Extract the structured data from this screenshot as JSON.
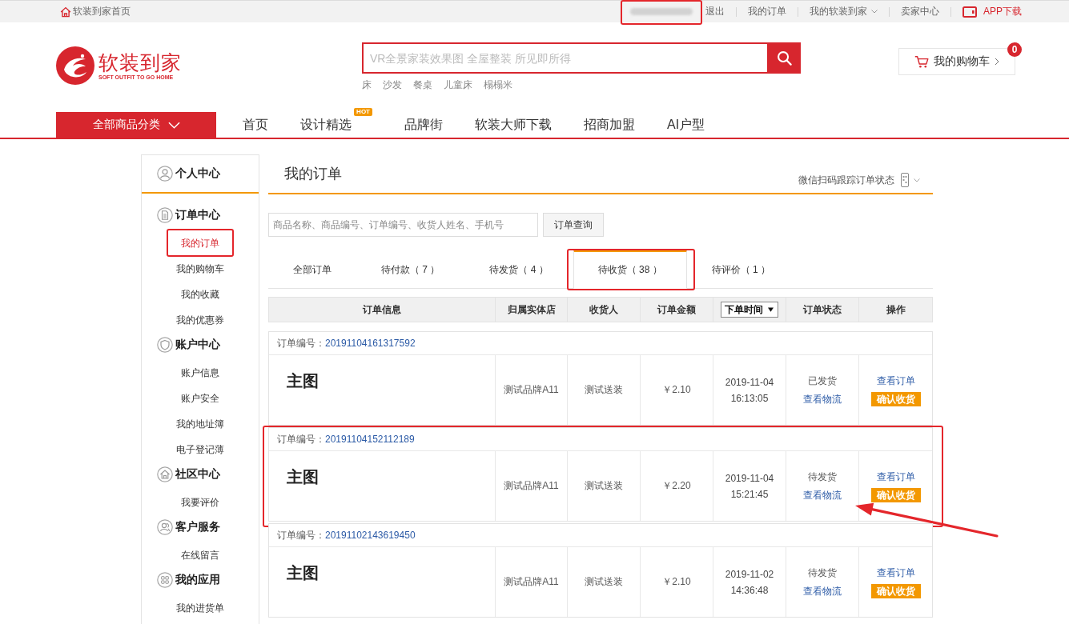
{
  "top_bar": {
    "home_link": "软装到家首页",
    "user": {
      "redacted": true,
      "highlighted": true
    },
    "links": [
      {
        "label": "退出",
        "kind": "link"
      },
      {
        "label": "我的订单",
        "kind": "link"
      },
      {
        "label": "我的软装到家",
        "kind": "menu"
      },
      {
        "label": "卖家中心",
        "kind": "link"
      },
      {
        "label": "APP下载",
        "kind": "app"
      }
    ]
  },
  "header": {
    "logo": {
      "name": "软装到家",
      "tagline": "SOFT OUTFIT TO GO HOME"
    },
    "search": {
      "placeholder": "VR全景家装效果图 全屋整装 所见即所得"
    },
    "hot_words": [
      "床",
      "沙发",
      "餐桌",
      "儿童床",
      "榻榻米"
    ],
    "cart": {
      "label": "我的购物车",
      "count": "0"
    }
  },
  "nav": {
    "category_button": "全部商品分类",
    "items": [
      {
        "label": "首页"
      },
      {
        "label": "设计精选",
        "badge": "HOT"
      },
      {
        "label": "品牌街"
      },
      {
        "label": "软装大师下载"
      },
      {
        "label": "招商加盟"
      },
      {
        "label": "AI户型"
      }
    ]
  },
  "sidebar": {
    "title": "个人中心",
    "groups": [
      {
        "title": "订单中心",
        "items": [
          {
            "label": "我的订单",
            "selected": true,
            "highlighted": true
          },
          {
            "label": "我的购物车",
            "selected": false,
            "highlighted": false
          },
          {
            "label": "我的收藏",
            "selected": false,
            "highlighted": false
          },
          {
            "label": "我的优惠券",
            "selected": false,
            "highlighted": false
          }
        ]
      },
      {
        "title": "账户中心",
        "items": [
          {
            "label": "账户信息",
            "selected": false,
            "highlighted": false
          },
          {
            "label": "账户安全",
            "selected": false,
            "highlighted": false
          },
          {
            "label": "我的地址簿",
            "selected": false,
            "highlighted": false
          },
          {
            "label": "电子登记薄",
            "selected": false,
            "highlighted": false
          }
        ]
      },
      {
        "title": "社区中心",
        "items": [
          {
            "label": "我要评价",
            "selected": false,
            "highlighted": false
          }
        ]
      },
      {
        "title": "客户服务",
        "items": [
          {
            "label": "在线留言",
            "selected": false,
            "highlighted": false
          }
        ]
      },
      {
        "title": "我的应用",
        "items": [
          {
            "label": "我的进货单",
            "selected": false,
            "highlighted": false
          }
        ]
      }
    ]
  },
  "main": {
    "title": "我的订单",
    "wechat_track": "微信扫码跟踪订单状态",
    "search": {
      "placeholder": "商品名称、商品编号、订单编号、收货人姓名、手机号",
      "button": "订单查询"
    },
    "tabs": [
      {
        "label": "全部订单",
        "selected": false,
        "highlighted": false
      },
      {
        "label": "待付款（ 7 ）",
        "selected": false,
        "highlighted": false
      },
      {
        "label": "待发货（ 4 ）",
        "selected": false,
        "highlighted": false
      },
      {
        "label": "待收货（ 38 ）",
        "selected": true,
        "highlighted": true
      },
      {
        "label": "待评价（ 1 ）",
        "selected": false,
        "highlighted": false
      }
    ],
    "columns": [
      {
        "label": "订单信息",
        "kind": "text"
      },
      {
        "label": "归属实体店",
        "kind": "text"
      },
      {
        "label": "收货人",
        "kind": "text"
      },
      {
        "label": "订单金额",
        "kind": "text"
      },
      {
        "label": "下单时间",
        "kind": "sort"
      },
      {
        "label": "订单状态",
        "kind": "text"
      },
      {
        "label": "操作",
        "kind": "text"
      }
    ],
    "orders": [
      {
        "number_label": "订单编号：",
        "number": "20191104161317592",
        "image_text": "主图",
        "store": "测试品牌A11",
        "receiver": "测试送装",
        "amount": "￥2.10",
        "date": "2019-11-04",
        "time": "16:13:05",
        "status": "已发货",
        "track_link": "查看物流",
        "view_link": "查看订单",
        "confirm_button": "确认收货",
        "highlighted": false,
        "arrow": false
      },
      {
        "number_label": "订单编号：",
        "number": "20191104152112189",
        "image_text": "主图",
        "store": "测试品牌A11",
        "receiver": "测试送装",
        "amount": "￥2.20",
        "date": "2019-11-04",
        "time": "15:21:45",
        "status": "待发货",
        "track_link": "查看物流",
        "view_link": "查看订单",
        "confirm_button": "确认收货",
        "highlighted": true,
        "arrow": true
      },
      {
        "number_label": "订单编号：",
        "number": "20191102143619450",
        "image_text": "主图",
        "store": "测试品牌A11",
        "receiver": "测试送装",
        "amount": "￥2.10",
        "date": "2019-11-02",
        "time": "14:36:48",
        "status": "待发货",
        "track_link": "查看物流",
        "view_link": "查看订单",
        "confirm_button": "确认收货",
        "highlighted": false,
        "arrow": false
      }
    ]
  }
}
